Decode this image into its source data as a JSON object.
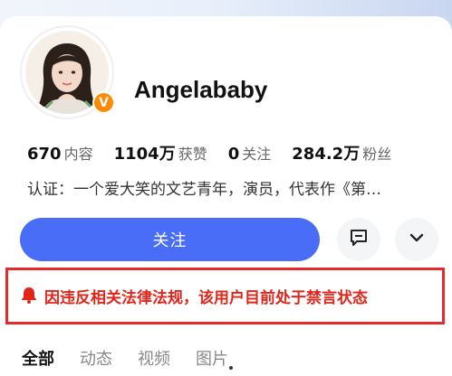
{
  "profile": {
    "username": "Angelababy",
    "verified_badge": "V",
    "bio": "认证：一个爱大笑的文艺青年，演员，代表作《第…"
  },
  "stats": [
    {
      "value": "670",
      "label": "内容"
    },
    {
      "value": "1104万",
      "label": "获赞"
    },
    {
      "value": "0",
      "label": "关注"
    },
    {
      "value": "284.2万",
      "label": "粉丝"
    }
  ],
  "actions": {
    "follow_label": "关注",
    "chat_icon": "chat-bubble-icon",
    "more_icon": "chevron-down-icon"
  },
  "notice": {
    "text": "因违反相关法律法规，该用户目前处于禁言状态",
    "icon": "bell-icon",
    "color": "#e1251b"
  },
  "tabs": [
    {
      "label": "全部",
      "active": true
    },
    {
      "label": "动态",
      "active": false
    },
    {
      "label": "视频",
      "active": false
    },
    {
      "label": "图片",
      "active": false
    }
  ],
  "colors": {
    "accent": "#4a6df7",
    "badge": "#ff8a00",
    "warning": "#e42a2a"
  }
}
